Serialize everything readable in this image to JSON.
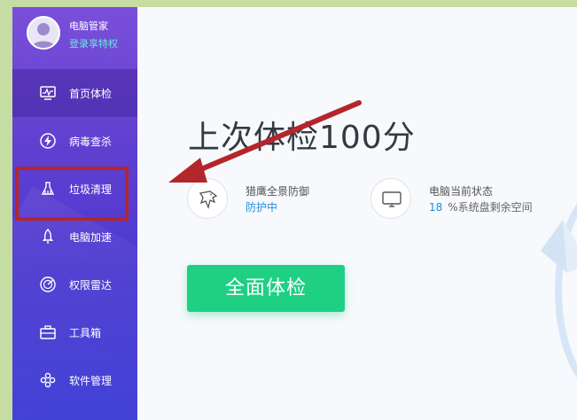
{
  "profile": {
    "name": "电脑管家",
    "login_label": "登录享特权"
  },
  "nav": {
    "items": [
      {
        "label": "首页体检",
        "icon": "monitor-pulse-icon",
        "active": true
      },
      {
        "label": "病毒查杀",
        "icon": "lightning-icon"
      },
      {
        "label": "垃圾清理",
        "icon": "broom-icon"
      },
      {
        "label": "电脑加速",
        "icon": "rocket-icon"
      },
      {
        "label": "权限雷达",
        "icon": "radar-icon"
      },
      {
        "label": "工具箱",
        "icon": "toolbox-icon"
      },
      {
        "label": "软件管理",
        "icon": "apps-icon"
      }
    ]
  },
  "main": {
    "score_text": "上次体检100分",
    "features": [
      {
        "title": "猎鹰全景防御",
        "value": "防护中",
        "icon": "eagle-icon"
      },
      {
        "title": "电脑当前状态",
        "value": "18",
        "value_suffix": "%系统盘剩余空间",
        "icon": "monitor-icon"
      }
    ],
    "scan_button_label": "全面体检"
  },
  "colors": {
    "sidebar_top": "#7a4fd9",
    "sidebar_bottom": "#3f3fd6",
    "accent_green": "#1fcf84",
    "accent_blue": "#1f8fdc",
    "annotation_red": "#b3262c",
    "login_cyan": "#5ff0d8"
  }
}
